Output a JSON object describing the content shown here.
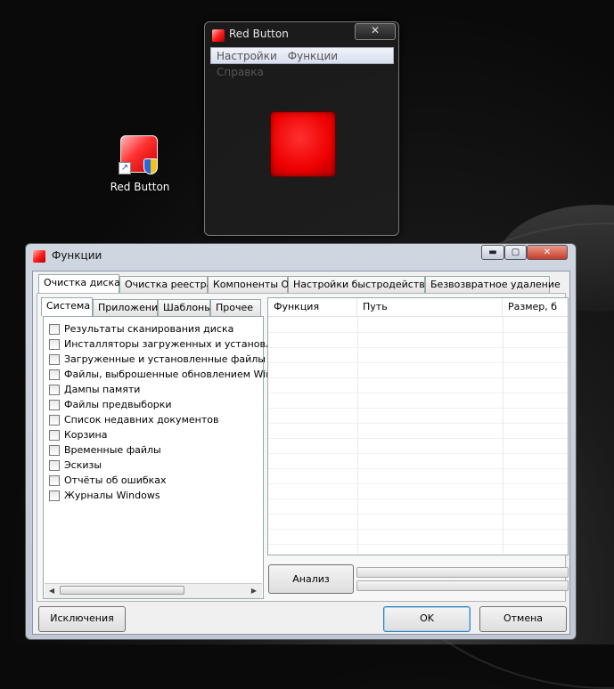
{
  "desktop": {
    "icon_label": "Red Button"
  },
  "red_button_window": {
    "title": "Red Button",
    "close_glyph": "✕",
    "menu": [
      "Настройки",
      "Функции",
      "Справка"
    ],
    "button_color": "#ee0000"
  },
  "functions_window": {
    "title": "Функции",
    "controls": {
      "minimize": "▬",
      "maximize": "▢",
      "close": "✕"
    },
    "main_tabs": [
      "Очистка диска",
      "Очистка реестра",
      "Компоненты ОС",
      "Настройки быстродействия",
      "Безвозвратное удаление"
    ],
    "active_main_tab": "Очистка диска",
    "sub_tabs": [
      "Система",
      "Приложения",
      "Шаблоны",
      "Прочее"
    ],
    "active_sub_tab": "Система",
    "checklist": [
      "Результаты сканирования диска",
      "Инсталляторы загруженных и установленн",
      "Загруженные и установленные файлы прог",
      "Файлы, выброшенные обновлением Window",
      "Дампы памяти",
      "Файлы предвыборки",
      "Список недавних документов",
      "Корзина",
      "Временные файлы",
      "Эскизы",
      "Отчёты об ошибках",
      "Журналы Windows"
    ],
    "scroll_left": "◀",
    "scroll_right": "▶",
    "columns": [
      "Функция",
      "Путь",
      "Размер, б"
    ],
    "analyze_button": "Анализ",
    "exclusions_button": "Исключения",
    "ok_button": "OK",
    "cancel_button": "Отмена"
  }
}
